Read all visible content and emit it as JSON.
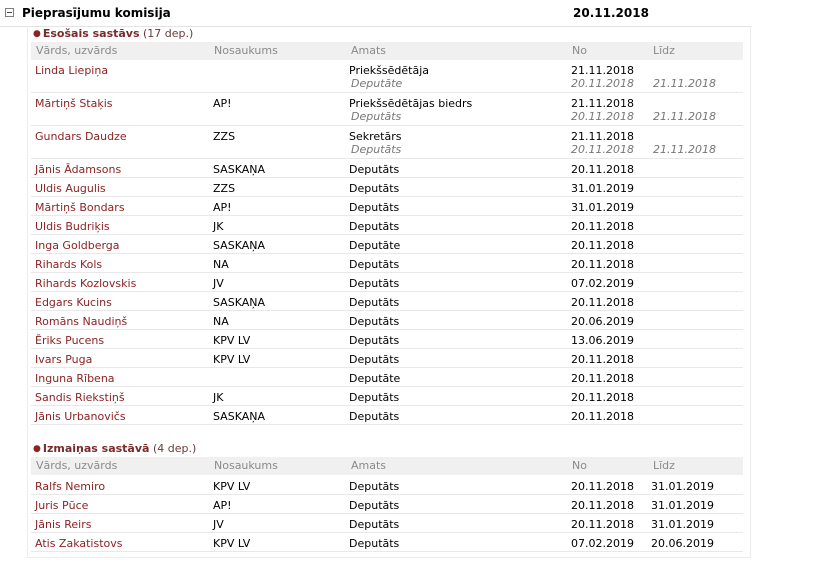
{
  "committee": {
    "name": "Pieprasījumu komisija",
    "date": "20.11.2018"
  },
  "columns": {
    "name": "Vārds, uzvārds",
    "party": "Nosaukums",
    "position": "Amats",
    "from": "No",
    "to": "Līdz"
  },
  "current": {
    "title": "Esošais sastāvs",
    "count": "(17 dep.)",
    "rows": [
      {
        "name": "Linda Liepiņa",
        "party": "",
        "position": "Priekšsēdētāja",
        "from": "21.11.2018",
        "to": "",
        "prev": {
          "position": "Deputāte",
          "from": "20.11.2018",
          "to": "21.11.2018"
        }
      },
      {
        "name": "Mārtiņš Staķis",
        "party": "AP!",
        "position": "Priekšsēdētājas biedrs",
        "from": "21.11.2018",
        "to": "",
        "prev": {
          "position": "Deputāts",
          "from": "20.11.2018",
          "to": "21.11.2018"
        }
      },
      {
        "name": "Gundars Daudze",
        "party": "ZZS",
        "position": "Sekretārs",
        "from": "21.11.2018",
        "to": "",
        "prev": {
          "position": "Deputāts",
          "from": "20.11.2018",
          "to": "21.11.2018"
        }
      },
      {
        "name": "Jānis Ādamsons",
        "party": "SASKAŅA",
        "position": "Deputāts",
        "from": "20.11.2018",
        "to": ""
      },
      {
        "name": "Uldis Augulis",
        "party": "ZZS",
        "position": "Deputāts",
        "from": "31.01.2019",
        "to": ""
      },
      {
        "name": "Mārtiņš Bondars",
        "party": "AP!",
        "position": "Deputāts",
        "from": "31.01.2019",
        "to": ""
      },
      {
        "name": "Uldis Budriķis",
        "party": "JK",
        "position": "Deputāts",
        "from": "20.11.2018",
        "to": ""
      },
      {
        "name": "Inga Goldberga",
        "party": "SASKAŅA",
        "position": "Deputāte",
        "from": "20.11.2018",
        "to": ""
      },
      {
        "name": "Rihards Kols",
        "party": "NA",
        "position": "Deputāts",
        "from": "20.11.2018",
        "to": ""
      },
      {
        "name": "Rihards Kozlovskis",
        "party": "JV",
        "position": "Deputāts",
        "from": "07.02.2019",
        "to": ""
      },
      {
        "name": "Edgars Kucins",
        "party": "SASKAŅA",
        "position": "Deputāts",
        "from": "20.11.2018",
        "to": ""
      },
      {
        "name": "Romāns Naudiņš",
        "party": "NA",
        "position": "Deputāts",
        "from": "20.06.2019",
        "to": ""
      },
      {
        "name": "Ēriks Pucens",
        "party": "KPV LV",
        "position": "Deputāts",
        "from": "13.06.2019",
        "to": ""
      },
      {
        "name": "Ivars Puga",
        "party": "KPV LV",
        "position": "Deputāts",
        "from": "20.11.2018",
        "to": ""
      },
      {
        "name": "Inguna Rībena",
        "party": "",
        "position": "Deputāte",
        "from": "20.11.2018",
        "to": ""
      },
      {
        "name": "Sandis Riekstiņš",
        "party": "JK",
        "position": "Deputāts",
        "from": "20.11.2018",
        "to": ""
      },
      {
        "name": "Jānis Urbanovičs",
        "party": "SASKAŅA",
        "position": "Deputāts",
        "from": "20.11.2018",
        "to": ""
      }
    ]
  },
  "changes": {
    "title": "Izmaiņas sastāvā",
    "count": "(4 dep.)",
    "rows": [
      {
        "name": "Ralfs Nemiro",
        "party": "KPV LV",
        "position": "Deputāts",
        "from": "20.11.2018",
        "to": "31.01.2019"
      },
      {
        "name": "Juris Pūce",
        "party": "AP!",
        "position": "Deputāts",
        "from": "20.11.2018",
        "to": "31.01.2019"
      },
      {
        "name": "Jānis Reirs",
        "party": "JV",
        "position": "Deputāts",
        "from": "20.11.2018",
        "to": "31.01.2019"
      },
      {
        "name": "Atis Zakatistovs",
        "party": "KPV LV",
        "position": "Deputāts",
        "from": "07.02.2019",
        "to": "20.06.2019"
      }
    ]
  }
}
